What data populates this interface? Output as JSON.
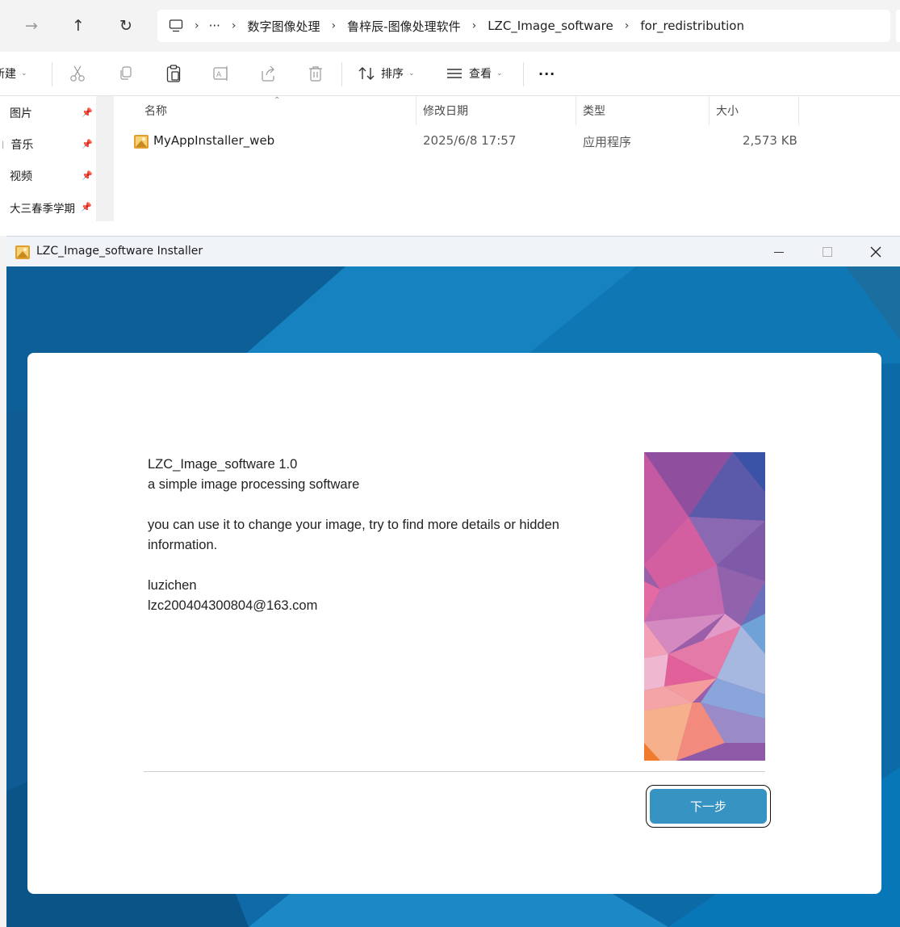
{
  "explorer": {
    "address": {
      "overflow": "···",
      "crumbs": [
        "数字图像处理",
        "鲁梓辰-图像处理软件",
        "LZC_Image_software",
        "for_redistribution"
      ]
    },
    "toolbar": {
      "new_label": "新建",
      "sort_label": "排序",
      "view_label": "查看",
      "more_label": "···"
    },
    "quick_access": [
      {
        "label": "图片"
      },
      {
        "label": "音乐"
      },
      {
        "label": "视频"
      },
      {
        "label": "大三春季学期"
      }
    ],
    "columns": {
      "name": "名称",
      "modified": "修改日期",
      "type": "类型",
      "size": "大小"
    },
    "files": [
      {
        "name": "MyAppInstaller_web",
        "modified": "2025/6/8 17:57",
        "type": "应用程序",
        "size": "2,573 KB"
      }
    ]
  },
  "installer": {
    "title": "LZC_Image_software Installer",
    "info": {
      "product": "LZC_Image_software 1.0",
      "tagline": "a simple image processing software",
      "description_1": "you can use it to change your image, try to find more details or hidden",
      "description_2": "information.",
      "author": "luzichen",
      "email": "lzc200404300804@163.com"
    },
    "next_label": "下一步"
  },
  "colors": {
    "accent": "#3693c2",
    "backdrop": "#0a6aa5"
  }
}
